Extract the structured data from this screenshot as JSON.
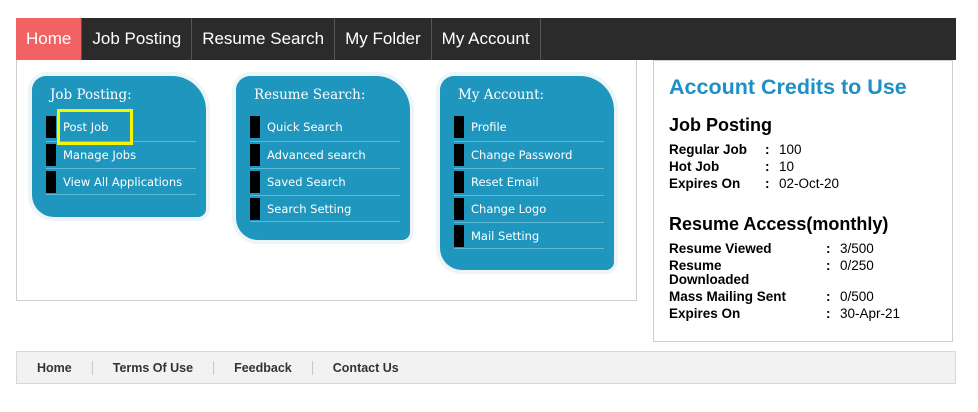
{
  "nav": {
    "items": [
      {
        "label": "Home",
        "active": true
      },
      {
        "label": "Job Posting"
      },
      {
        "label": "Resume Search"
      },
      {
        "label": "My Folder"
      },
      {
        "label": "My Account"
      }
    ]
  },
  "job_posting_box": {
    "title": "Job Posting:",
    "items": [
      "Post Job",
      "Manage Jobs",
      "View All Applications"
    ]
  },
  "resume_search_box": {
    "title": "Resume Search:",
    "items": [
      "Quick Search",
      "Advanced search",
      "Saved Search",
      "Search Setting"
    ]
  },
  "my_account_box": {
    "title": "My Account:",
    "items": [
      "Profile",
      "Change Password",
      "Reset Email",
      "Change Logo",
      "Mail Setting"
    ]
  },
  "credits": {
    "title": "Account Credits to Use",
    "job_posting": {
      "heading": "Job Posting",
      "regular_job_label": "Regular Job",
      "regular_job_value": "100",
      "hot_job_label": "Hot Job",
      "hot_job_value": "10",
      "expires_label": "Expires On",
      "expires_value": "02-Oct-20"
    },
    "resume_access": {
      "heading": "Resume Access(monthly)",
      "viewed_label": "Resume Viewed",
      "viewed_value": "3/500",
      "downloaded_label_1": "Resume",
      "downloaded_label_2": "Downloaded",
      "downloaded_value": "0/250",
      "mailing_label": "Mass Mailing Sent",
      "mailing_value": "0/500",
      "expires_label": "Expires On",
      "expires_value": "30-Apr-21"
    },
    "colon": ":"
  },
  "footer": {
    "links": [
      "Home",
      "Terms Of Use",
      "Feedback",
      "Contact Us"
    ]
  },
  "colors": {
    "nav_bg": "#2b2b2b",
    "nav_active": "#f26262",
    "menu_box": "#1e96be",
    "credits_title": "#1e8fc7",
    "highlight": "#f5f500"
  }
}
